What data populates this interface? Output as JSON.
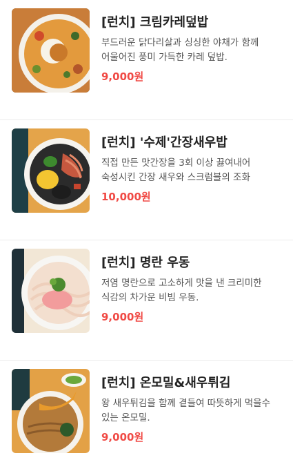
{
  "menu": {
    "items": [
      {
        "title": "[런치] 크림카레덮밥",
        "description": "부드러운 닭다리살과 싱싱한 야채가 함께 어울어진 풍미 가득한 카레 덮밥.",
        "price": "9,000원",
        "image_icon": "cream-curry-rice-image"
      },
      {
        "title": "[런치] '수제'간장새우밥",
        "description": "직접 만든 맛간장을 3회 이상 끓여내어 숙성시킨 간장 새우와 스크럼블의 조화",
        "price": "10,000원",
        "image_icon": "soy-shrimp-rice-image"
      },
      {
        "title": "[런치] 명란 우동",
        "description": "저염 명란으로 고소하게 맛을 낸 크리미한 식감의 차가운 비빔 우동.",
        "price": "9,000원",
        "image_icon": "mentaiko-udon-image"
      },
      {
        "title": "[런치] 온모밀&새우튀김",
        "description": "왕 새우튀김을 함께 곁들여 따뜻하게 먹을수 있는 온모밀.",
        "price": "9,000원",
        "image_icon": "soba-shrimp-tempura-image"
      }
    ]
  },
  "colors": {
    "price": "#f04a45",
    "title": "#222222",
    "description": "#555555",
    "divider": "#ececec"
  }
}
